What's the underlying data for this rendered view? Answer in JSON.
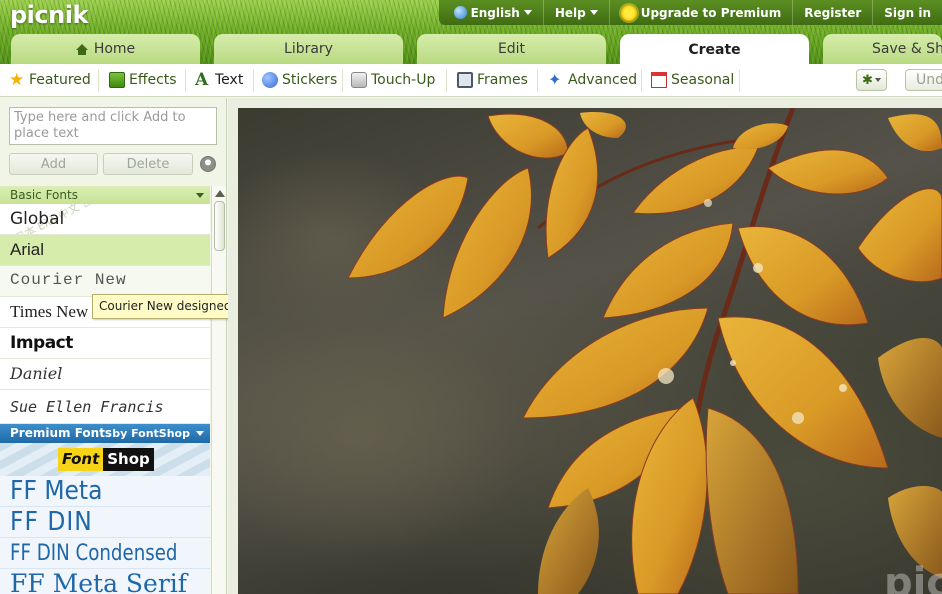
{
  "app": {
    "logo": "picnik"
  },
  "topbar": {
    "language": "English",
    "help": "Help",
    "upgrade": "Upgrade to Premium",
    "register": "Register",
    "signin": "Sign in"
  },
  "tabs": {
    "home": "Home",
    "library": "Library",
    "edit": "Edit",
    "create": "Create",
    "save": "Save & Share"
  },
  "subtabs": {
    "featured": "Featured",
    "effects": "Effects",
    "text": "Text",
    "stickers": "Stickers",
    "touchup": "Touch-Up",
    "frames": "Frames",
    "advanced": "Advanced",
    "seasonal": "Seasonal",
    "undo": "Undo"
  },
  "textpanel": {
    "placeholder": "Type here and click Add to place text",
    "add": "Add",
    "delete": "Delete"
  },
  "basic_fonts": {
    "header": "Basic Fonts",
    "items": [
      "Global",
      "Arial",
      "Courier New",
      "Times New Roman",
      "Impact",
      "Daniel",
      "Sue Ellen Francis"
    ]
  },
  "premium_fonts": {
    "header": "Premium Fonts",
    "by": "by FontShop",
    "logo_a": "Font",
    "logo_b": "Shop",
    "items": [
      "FF Meta",
      "FF DIN",
      "FF DIN Condensed",
      "FF Meta Serif"
    ]
  },
  "tooltip": "Courier New designed by Howard \"Bud\" Kettler",
  "photo": {
    "watermark": "pic"
  }
}
